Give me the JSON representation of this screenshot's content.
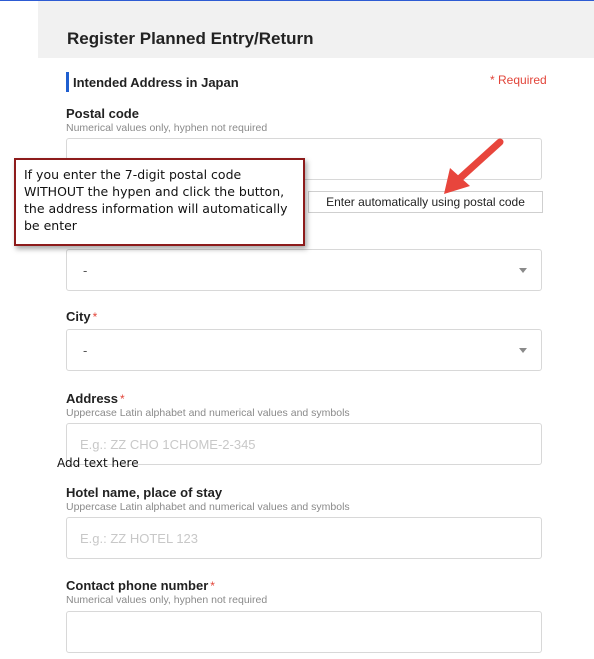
{
  "header": {
    "title": "Register Planned Entry/Return"
  },
  "section": {
    "title": "Intended Address in Japan",
    "required_note": "* Required"
  },
  "postal": {
    "label": "Postal code",
    "hint": "Numerical values only, hyphen not required",
    "value": "",
    "auto_button": "Enter automatically using postal code"
  },
  "prefecture": {
    "selected": "-"
  },
  "city": {
    "label": "City",
    "required_mark": "*",
    "selected": "-"
  },
  "address": {
    "label": "Address",
    "required_mark": "*",
    "hint": "Uppercase Latin alphabet and numerical values and symbols",
    "placeholder": "E.g.: ZZ CHO 1CHOME-2-345"
  },
  "hotel": {
    "label": "Hotel name, place of stay",
    "hint": "Uppercase Latin alphabet and numerical values and symbols",
    "placeholder": "E.g.: ZZ HOTEL 123"
  },
  "phone": {
    "label": "Contact phone number",
    "required_mark": "*",
    "hint": "Numerical values only, hyphen not required",
    "value": ""
  },
  "annotation": {
    "callout_text": "If you enter the 7-digit postal code WITHOUT the hypen and click the button, the address information will automatically be enter",
    "added_text": "Add text here"
  },
  "colors": {
    "accent": "#1f5fd0",
    "required": "#e2453a",
    "callout_border": "#8d1b1b",
    "arrow": "#e8453c"
  }
}
